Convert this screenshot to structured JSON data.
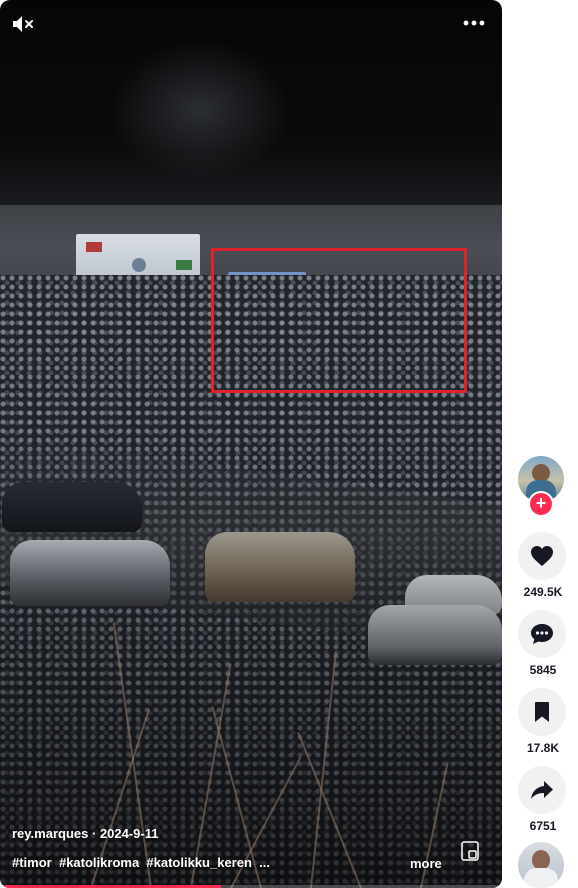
{
  "video": {
    "author": "rey.marques",
    "date": "2024-9-11",
    "hashtags": [
      "#timor",
      "#katolikroma",
      "#katolikku_keren",
      "..."
    ],
    "more_label": "more",
    "progress_fraction": 0.44,
    "highlight_color": "#e0222a"
  },
  "hud": {
    "mute_icon": "speaker-muted-icon",
    "menu_icon": "more-options-icon",
    "pip_icon": "picture-in-picture-icon"
  },
  "actions": {
    "likes": "249.5K",
    "comments": "5845",
    "saves": "17.8K",
    "shares": "6751"
  },
  "colors": {
    "accent": "#fe2c55",
    "action_bg": "#f1f1f2",
    "text_dark": "#161823"
  }
}
